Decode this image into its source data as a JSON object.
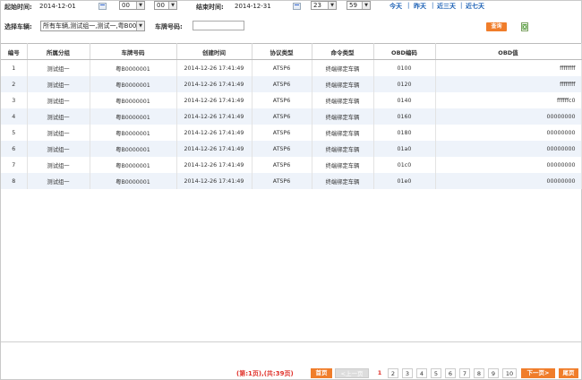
{
  "filters": {
    "start_label": "起始时间:",
    "start_date": "2014-12-01",
    "start_hour": "00",
    "start_minute": "00",
    "end_label": "结束时间:",
    "end_date": "2014-12-31",
    "end_hour": "23",
    "end_minute": "59",
    "quick": [
      "今天",
      "昨天",
      "近三天",
      "近七天"
    ],
    "quick_sep": "|",
    "vehicle_label": "选择车辆:",
    "vehicle_value": "所有车辆,测试组一,测试一,粤B00",
    "plate_label": "车牌号码:",
    "plate_value": "",
    "query_button": "查询"
  },
  "table": {
    "headers": [
      "编号",
      "所属分组",
      "车牌号码",
      "创建时间",
      "协议类型",
      "命令类型",
      "OBD编码",
      "OBD值"
    ],
    "rows": [
      [
        "1",
        "测试组一",
        "粤B0000001",
        "2014-12-26 17:41:49",
        "ATSP6",
        "终端绑定车辆",
        "0100",
        "ffffffff"
      ],
      [
        "2",
        "测试组一",
        "粤B0000001",
        "2014-12-26 17:41:49",
        "ATSP6",
        "终端绑定车辆",
        "0120",
        "ffffffff"
      ],
      [
        "3",
        "测试组一",
        "粤B0000001",
        "2014-12-26 17:41:49",
        "ATSP6",
        "终端绑定车辆",
        "0140",
        "ffffffc0"
      ],
      [
        "4",
        "测试组一",
        "粤B0000001",
        "2014-12-26 17:41:49",
        "ATSP6",
        "终端绑定车辆",
        "0160",
        "00000000"
      ],
      [
        "5",
        "测试组一",
        "粤B0000001",
        "2014-12-26 17:41:49",
        "ATSP6",
        "终端绑定车辆",
        "0180",
        "00000000"
      ],
      [
        "6",
        "测试组一",
        "粤B0000001",
        "2014-12-26 17:41:49",
        "ATSP6",
        "终端绑定车辆",
        "01a0",
        "00000000"
      ],
      [
        "7",
        "测试组一",
        "粤B0000001",
        "2014-12-26 17:41:49",
        "ATSP6",
        "终端绑定车辆",
        "01c0",
        "00000000"
      ],
      [
        "8",
        "测试组一",
        "粤B0000001",
        "2014-12-26 17:41:49",
        "ATSP6",
        "终端绑定车辆",
        "01e0",
        "00000000"
      ]
    ]
  },
  "pager": {
    "info": "(第:1页),(共:39页)",
    "first": "首页",
    "prev": "<上一页",
    "pages": [
      "1",
      "2",
      "3",
      "4",
      "5",
      "6",
      "7",
      "8",
      "9",
      "10"
    ],
    "next": "下一页>",
    "last": "尾页",
    "current": "1"
  },
  "colors": {
    "accent": "#f07d2a",
    "link": "#1a5fb4",
    "alt_row": "#eef3fa",
    "pager_info": "#e0312a"
  }
}
